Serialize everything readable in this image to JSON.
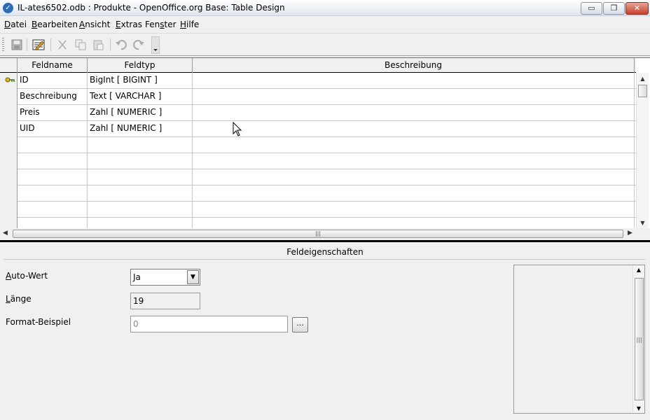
{
  "window": {
    "title": "IL-ates6502.odb : Produkte - OpenOffice.org Base: Table Design",
    "icon": "openoffice-icon",
    "controls": {
      "minimize": "▭",
      "maximize": "❐",
      "close": "✕"
    }
  },
  "menu": {
    "items": [
      {
        "label": "Datei",
        "u": "D",
        "rest": "atei"
      },
      {
        "label": "Bearbeiten",
        "u": "B",
        "rest": "earbeiten"
      },
      {
        "label": "Ansicht",
        "u": "A",
        "rest": "nsicht"
      },
      {
        "label": "Extras",
        "u": "E",
        "rest": "xtras"
      },
      {
        "label": "Fenster",
        "pre": "Fen",
        "u": "s",
        "rest": "ter"
      },
      {
        "label": "Hilfe",
        "u": "H",
        "rest": "ilfe"
      }
    ]
  },
  "toolbar": {
    "icons": [
      "save-icon",
      "index-design-icon",
      "cut-icon",
      "copy-icon",
      "paste-icon",
      "undo-icon",
      "redo-icon"
    ]
  },
  "grid": {
    "headers": {
      "feldname": "Feldname",
      "feldtyp": "Feldtyp",
      "beschreibung": "Beschreibung"
    },
    "rows": [
      {
        "name": "ID",
        "type": "BigInt [ BIGINT ]",
        "desc": "",
        "primary_key": true
      },
      {
        "name": "Beschreibung",
        "type": "Text [ VARCHAR ]",
        "desc": ""
      },
      {
        "name": "Preis",
        "type": "Zahl [ NUMERIC ]",
        "desc": ""
      },
      {
        "name": "UID",
        "type": "Zahl [ NUMERIC ]",
        "desc": ""
      },
      {
        "name": "",
        "type": "",
        "desc": ""
      },
      {
        "name": "",
        "type": "",
        "desc": ""
      },
      {
        "name": "",
        "type": "",
        "desc": ""
      },
      {
        "name": "",
        "type": "",
        "desc": ""
      },
      {
        "name": "",
        "type": "",
        "desc": ""
      },
      {
        "name": "",
        "type": "",
        "desc": ""
      }
    ]
  },
  "properties": {
    "title": "Feldeigenschaften",
    "auto_wert": {
      "label_u": "A",
      "label_rest": "uto-Wert",
      "value": "Ja"
    },
    "laenge": {
      "label_u": "L",
      "label_rest": "änge",
      "value": "19"
    },
    "format": {
      "label": "Format-Beispiel",
      "value": "0",
      "button": "..."
    }
  }
}
